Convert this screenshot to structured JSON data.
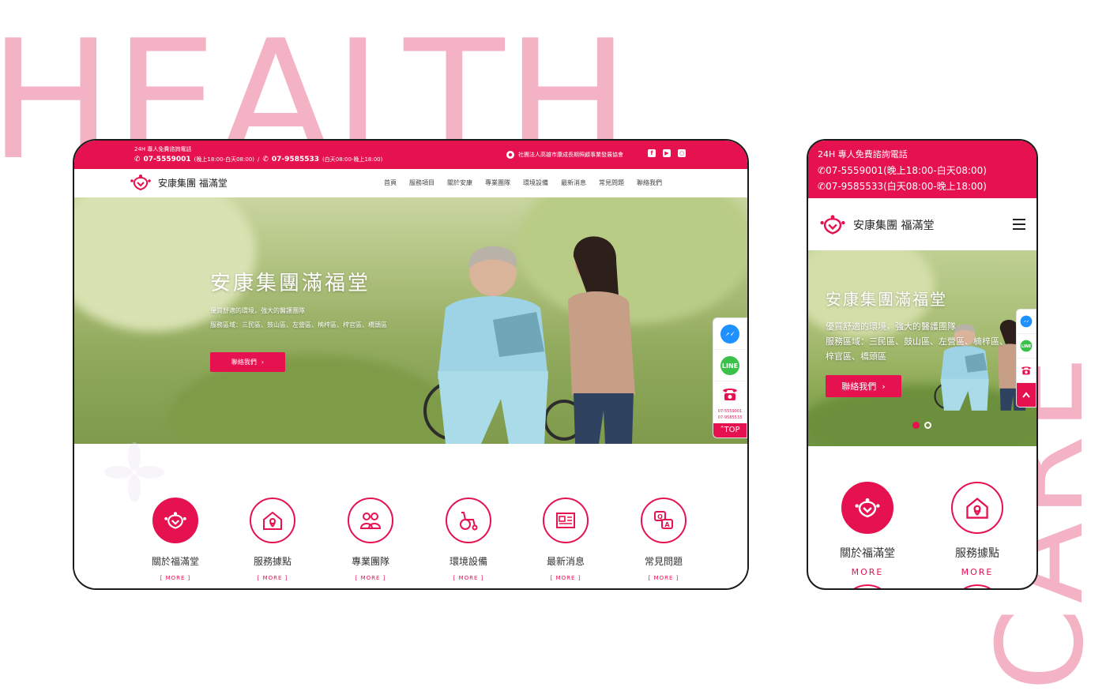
{
  "background": {
    "word_top": "HEALTH",
    "word_side": "CARE",
    "accent_color": "#e6114f",
    "word_color": "#f4b3c5"
  },
  "desktop": {
    "topbar": {
      "hotline_label": "24H 專人免費諮詢電話",
      "phone1": "07-5559001",
      "phone1_hours": "(晚上18:00-白天08:00)",
      "separator": "/",
      "phone2": "07-9585533",
      "phone2_hours": "(白天08:00-晚上18:00)",
      "association": "社團法人高雄市康成長期照顧事業發展協會",
      "social_icons": [
        "facebook-icon",
        "youtube-icon",
        "instagram-icon"
      ]
    },
    "nav": {
      "logo_text": "安康集團 福滿堂",
      "menu": [
        "首頁",
        "服務項目",
        "關於安康",
        "專業團隊",
        "環境設備",
        "最新消息",
        "常見問題",
        "聯絡我們"
      ]
    },
    "hero": {
      "title": "安康集團滿福堂",
      "line1": "優質舒適的環境，強大的醫護團隊",
      "line2": "服務區域：三民區、鼓山區、左營區、楠梓區、梓官區、橋頭區",
      "button": "聯絡我們"
    },
    "side_tools": {
      "phone_small1": "07-5559001",
      "phone_small2": "07-9585533",
      "top_label": "TOP"
    },
    "features": [
      {
        "label": "關於福滿堂",
        "more": "MORE",
        "icon": "logo-icon"
      },
      {
        "label": "服務據點",
        "more": "MORE",
        "icon": "house-pin-icon"
      },
      {
        "label": "專業團隊",
        "more": "MORE",
        "icon": "team-icon"
      },
      {
        "label": "環境設備",
        "more": "MORE",
        "icon": "wheelchair-icon"
      },
      {
        "label": "最新消息",
        "more": "MORE",
        "icon": "newspaper-icon"
      },
      {
        "label": "常見問題",
        "more": "MORE",
        "icon": "qa-icon"
      }
    ]
  },
  "mobile": {
    "topbar": {
      "hotline_label": "24H 專人免費諮詢電話",
      "phone1": "07-5559001(晚上18:00-白天08:00)",
      "phone2": "07-9585533(白天08:00-晚上18:00)"
    },
    "nav": {
      "logo_text": "安康集團 福滿堂"
    },
    "hero": {
      "title": "安康集團滿福堂",
      "line1": "優質舒適的環境，強大的醫護團隊",
      "line2": "服務區域：三民區、鼓山區、左營區、楠梓區、",
      "line3": "梓官區、橋頭區",
      "button": "聯絡我們"
    },
    "features": [
      {
        "label": "關於福滿堂",
        "more": "MORE",
        "icon": "logo-icon"
      },
      {
        "label": "服務據點",
        "more": "MORE",
        "icon": "house-pin-icon"
      }
    ]
  }
}
